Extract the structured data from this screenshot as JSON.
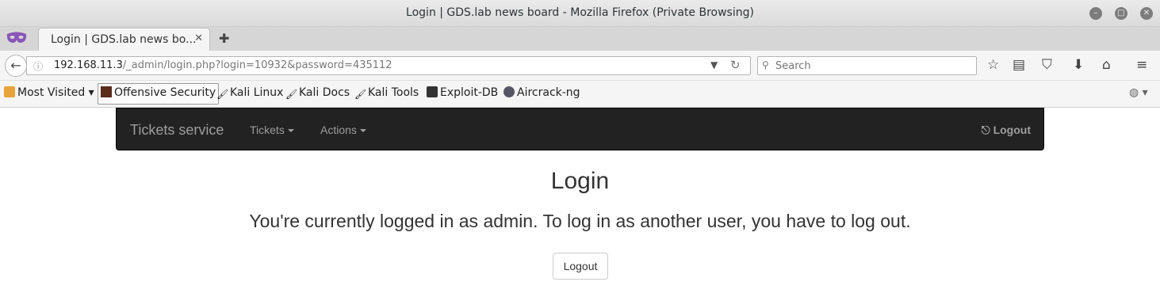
{
  "window": {
    "title": "Login | GDS.lab news board - Mozilla Firefox (Private Browsing)"
  },
  "tabs": [
    {
      "label": "Login | GDS.lab news bo...",
      "active": true
    }
  ],
  "urlbar": {
    "host": "192.168.11.3",
    "path": "/_admin/login.php?login=10932&password=435112"
  },
  "search": {
    "placeholder": "Search"
  },
  "bookmarks": [
    {
      "label": "Most Visited ▾"
    },
    {
      "label": "Offensive Security"
    },
    {
      "label": "Kali Linux"
    },
    {
      "label": "Kali Docs"
    },
    {
      "label": "Kali Tools"
    },
    {
      "label": "Exploit-DB"
    },
    {
      "label": "Aircrack-ng"
    }
  ],
  "app": {
    "brand": "Tickets service",
    "nav": [
      {
        "label": "Tickets"
      },
      {
        "label": "Actions"
      }
    ],
    "logout_label": "Logout"
  },
  "main": {
    "heading": "Login",
    "message": "You're currently logged in as admin. To log in as another user, you have to log out.",
    "button_label": "Logout"
  },
  "colors": {
    "navbar_bg": "#222222",
    "navbar_text": "#9d9d9d"
  }
}
